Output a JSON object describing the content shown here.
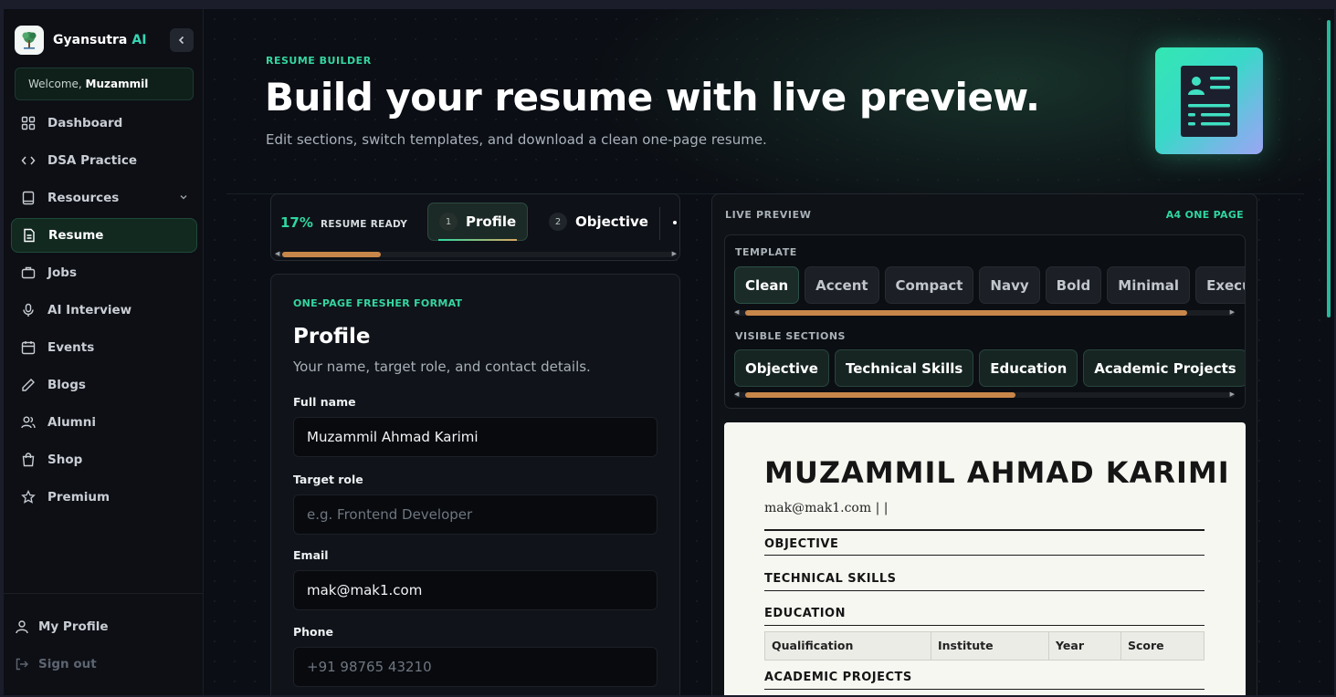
{
  "brand": {
    "name": "Gyansutra",
    "suffix": "AI"
  },
  "welcome": {
    "prefix": "Welcome,",
    "user": "Muzammil"
  },
  "nav": [
    {
      "label": "Dashboard",
      "icon": "dashboard-icon"
    },
    {
      "label": "DSA Practice",
      "icon": "code-icon"
    },
    {
      "label": "Resources",
      "icon": "book-icon"
    },
    {
      "label": "Resume",
      "icon": "document-icon",
      "active": true
    },
    {
      "label": "Jobs",
      "icon": "briefcase-icon"
    },
    {
      "label": "AI Interview",
      "icon": "microphone-icon"
    },
    {
      "label": "Events",
      "icon": "calendar-icon"
    },
    {
      "label": "Blogs",
      "icon": "pen-icon"
    },
    {
      "label": "Alumni",
      "icon": "users-icon"
    },
    {
      "label": "Shop",
      "icon": "shopping-bag-icon"
    },
    {
      "label": "Premium",
      "icon": "star-icon"
    }
  ],
  "sidebar_bottom": {
    "profile": "My Profile",
    "signout": "Sign out"
  },
  "hero": {
    "eyebrow": "RESUME BUILDER",
    "title": "Build your resume with live preview.",
    "subtitle": "Edit sections, switch templates, and download a clean one-page resume."
  },
  "progress": {
    "percent": "17%",
    "label": "RESUME READY",
    "steps": [
      {
        "num": "1",
        "label": "Profile"
      },
      {
        "num": "2",
        "label": "Objective"
      }
    ]
  },
  "form": {
    "eyebrow": "ONE-PAGE FRESHER FORMAT",
    "title": "Profile",
    "subtitle": "Your name, target role, and contact details.",
    "fields": [
      {
        "label": "Full name",
        "value": "Muzammil Ahmad Karimi",
        "placeholder": ""
      },
      {
        "label": "Target role",
        "value": "",
        "placeholder": "e.g. Frontend Developer"
      },
      {
        "label": "Email",
        "value": "mak@mak1.com",
        "placeholder": ""
      },
      {
        "label": "Phone",
        "value": "",
        "placeholder": "+91 98765 43210"
      }
    ]
  },
  "preview": {
    "label": "LIVE PREVIEW",
    "badge": "A4 ONE PAGE",
    "template_label": "TEMPLATE",
    "templates": [
      "Clean",
      "Accent",
      "Compact",
      "Navy",
      "Bold",
      "Minimal",
      "Executive"
    ],
    "selected_template": "Clean",
    "sections_label": "VISIBLE SECTIONS",
    "sections": [
      "Objective",
      "Technical Skills",
      "Education",
      "Academic Projects"
    ]
  },
  "resume": {
    "name": "MUZAMMIL AHMAD KARIMI",
    "contact": "mak@mak1.com | |",
    "headings": {
      "objective": "OBJECTIVE",
      "skills": "TECHNICAL SKILLS",
      "education": "EDUCATION",
      "projects": "ACADEMIC PROJECTS"
    },
    "education_columns": [
      "Qualification",
      "Institute",
      "Year",
      "Score"
    ]
  }
}
